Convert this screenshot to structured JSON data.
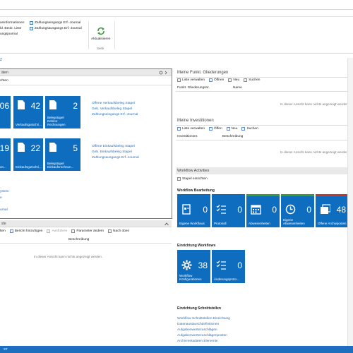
{
  "ribbon": {
    "items_left": [
      "aninformationen",
      "ld. Beob. Liste",
      "ungsjournal"
    ],
    "items_mid": [
      "Zahlungseingangs Erf.-Journal",
      "Zahlungsausgangs Erf.-Journal"
    ],
    "refresh_label": "Aktualisieren",
    "group_label": "Seite"
  },
  "breadcrumb": "Z",
  "left_panel": {
    "title": "äten",
    "subline": "chten",
    "sales_tiles": [
      {
        "num": "06",
        "label": ""
      },
      {
        "num": "42",
        "label": "Verkaufsgutschri..."
      },
      {
        "num": "2",
        "label": "Belegstapel Debitor Rechnungen"
      }
    ],
    "sales_links": [
      "Offene Verkaufsbeleg Stapel",
      "Geb. Verkaufsbeleg Stapel",
      "Zahlungseingangs Erf.-Journal"
    ],
    "purchase_tiles": [
      {
        "num": "19",
        "label": "on..."
      },
      {
        "num": "22",
        "label": "Einkaufsgutschri..."
      },
      {
        "num": "5",
        "label": "Belegstapel Einkaufsrechnun..."
      }
    ],
    "purchase_links": [
      "Offene Einkaufsbeleg Stapel",
      "Geb. Einkaufsbeleg Stapel",
      "Zahlungsausgangs Erf.-Journal"
    ],
    "bottom_links": [
      "ystem",
      "e",
      "urnal"
    ]
  },
  "lower_left_panel": {
    "title": "ste",
    "toolbar": [
      "lten",
      "Bericht hinzufügen",
      "Ausführen",
      "Parameter ändern",
      "Nach oben"
    ],
    "column": "Beschreibung",
    "empty": "In dieser Ansicht kann nichts angezeigt werden."
  },
  "gliederungen": {
    "title": "Meine Funkt. Gliederungen",
    "toolbar": [
      "Liste verwalten",
      "Öffnen",
      "Neu",
      "Suchen"
    ],
    "columns": [
      "Funkt. Gliederungsnr.",
      "Name"
    ],
    "empty": "In dieser Ansicht kann nichts angezeigt werden"
  },
  "investitionen": {
    "title": "Meine Investitionen",
    "toolbar": [
      "Liste verwalten",
      "Öffen",
      "Neu",
      "Suchen"
    ],
    "columns": [
      "Investitionsnr.",
      "Beschreibung"
    ],
    "empty": "In dieser Ansicht kann nichts angezeigt werden"
  },
  "workflow": {
    "title": "Workflow Activities",
    "action": "Stapel einrichten",
    "bearbeitung_title": "Workflow Bearbeitung",
    "bearbeitung_tiles": [
      {
        "num": "0",
        "label": "Eigene Workflows",
        "icon": "document-icon",
        "accent": "#0f6dbf"
      },
      {
        "num": "0",
        "label": "Protokoll",
        "icon": "list-icon",
        "accent": "#0f6dbf"
      },
      {
        "num": "0",
        "label": "Abwesenheiten",
        "icon": "calendar-icon",
        "accent": "#3a9b3a"
      },
      {
        "num": "0",
        "label": "Eigene Abwesenheiten",
        "icon": "clock-icon",
        "accent": "#3a9b3a"
      },
      {
        "num": "48",
        "label": "Offene Archivposten",
        "icon": "folder-icon",
        "accent": "#c0392b"
      }
    ],
    "einrichtung_title": "Einrichtung Workflows",
    "einrichtung_tiles": [
      {
        "num": "38",
        "label": "Workflow Konfigurationen",
        "icon": "gear-icon"
      },
      {
        "num": "0",
        "label": "Änderungsproto...",
        "icon": "list-icon"
      }
    ],
    "schnitt_title": "Einrichtung Schnittstellen",
    "schnitt_links": [
      "Workflow Schnittstellen Einrichtung",
      "Datenaustauschdefinitionen",
      "Aufgabenwertezuschlägen",
      "Aufgabenwertezuschlägenposten",
      "Archivmetadaten Elemente"
    ]
  },
  "colors": {
    "tile_blue": "#0f6dbf",
    "link": "#2d6fb6",
    "status": "#1f6fbf"
  }
}
